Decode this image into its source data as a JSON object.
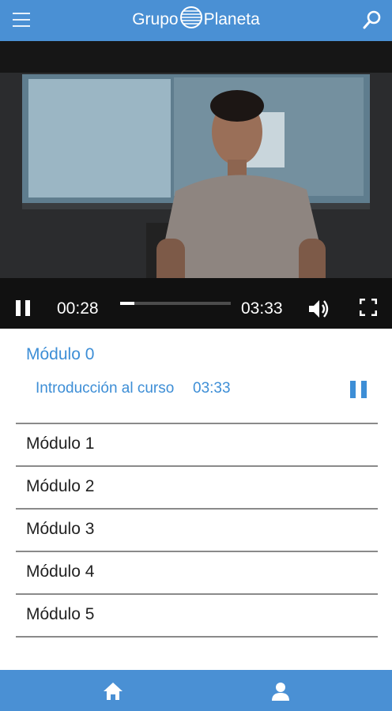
{
  "header": {
    "brand_left": "Grupo",
    "brand_right": "Planeta",
    "icons": [
      "menu-icon",
      "globe-logo-icon",
      "search-icon"
    ],
    "color": "#4a90d4"
  },
  "player": {
    "current_time": "00:28",
    "total_time": "03:33",
    "progress": 0.13,
    "icons": [
      "pause-icon",
      "volume-icon",
      "fullscreen-icon"
    ]
  },
  "course": {
    "active_module": "Módulo 0",
    "active_lesson": {
      "title": "Introducción al curso",
      "duration": "03:33",
      "icon": "pause-icon"
    },
    "modules": [
      "Módulo 1",
      "Módulo 2",
      "Módulo 3",
      "Módulo 4",
      "Módulo 5"
    ],
    "accent": "#3d8ed6"
  },
  "bottom_nav": {
    "icons": [
      "home-icon",
      "user-icon"
    ]
  }
}
